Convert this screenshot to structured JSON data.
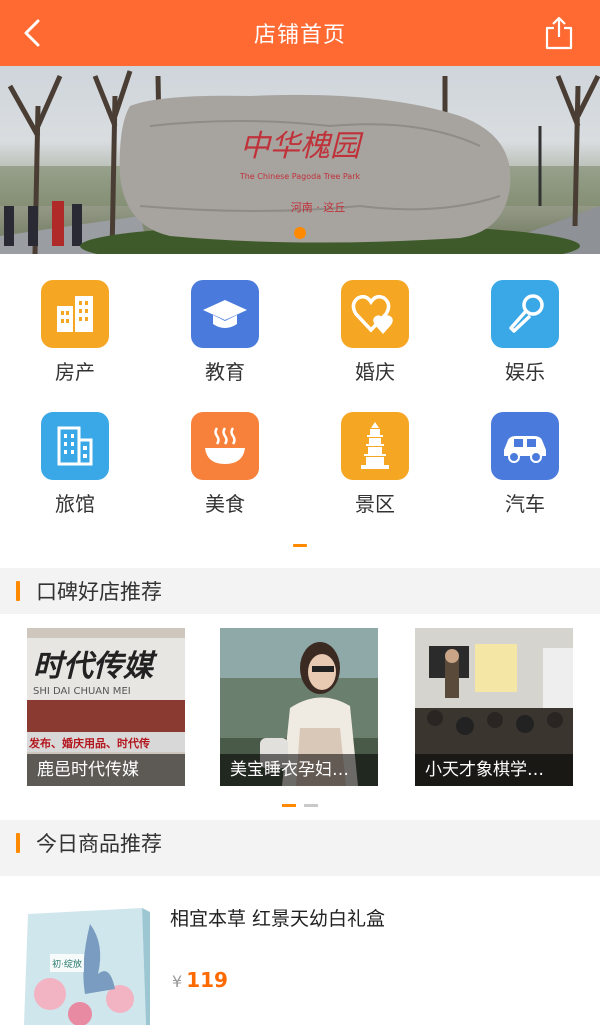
{
  "header": {
    "title": "店铺首页",
    "back_icon": "chevron-left-icon",
    "share_icon": "share-icon"
  },
  "banner": {
    "stone_text": "中华槐园",
    "stone_subtitle": "The Chinese Pagoda Tree Park",
    "stone_place": "河南 · 这丘",
    "active_slide": 1
  },
  "categories": [
    {
      "label": "房产",
      "icon": "buildings-icon",
      "color": "#f5a623"
    },
    {
      "label": "教育",
      "icon": "graduation-cap-icon",
      "color": "#4a7bdc"
    },
    {
      "label": "婚庆",
      "icon": "hearts-icon",
      "color": "#f5a623"
    },
    {
      "label": "娱乐",
      "icon": "microphone-icon",
      "color": "#3aa8e6"
    },
    {
      "label": "旅馆",
      "icon": "hotel-icon",
      "color": "#3aa8e6"
    },
    {
      "label": "美食",
      "icon": "bowl-icon",
      "color": "#f7803b"
    },
    {
      "label": "景区",
      "icon": "pagoda-icon",
      "color": "#f5a623"
    },
    {
      "label": "汽车",
      "icon": "car-icon",
      "color": "#4a7bdc"
    }
  ],
  "sections": {
    "shops_title": "口碑好店推荐",
    "products_title": "今日商品推荐"
  },
  "shops": [
    {
      "name": "鹿邑时代传媒",
      "sign_main": "时代传媒",
      "sign_pinyin": "SHI DAI CHUAN MEI",
      "sign_bottom": "发布、婚庆用品、时代传"
    },
    {
      "name": "美宝睡衣孕妇…"
    },
    {
      "name": "小天才象棋学…"
    }
  ],
  "product": {
    "name": "相宜本草 红景天幼白礼盒",
    "currency": "¥",
    "price": "119",
    "box_text": "初·绽放"
  },
  "colors": {
    "accent": "#ff6a33",
    "indicator": "#ff8a00"
  }
}
